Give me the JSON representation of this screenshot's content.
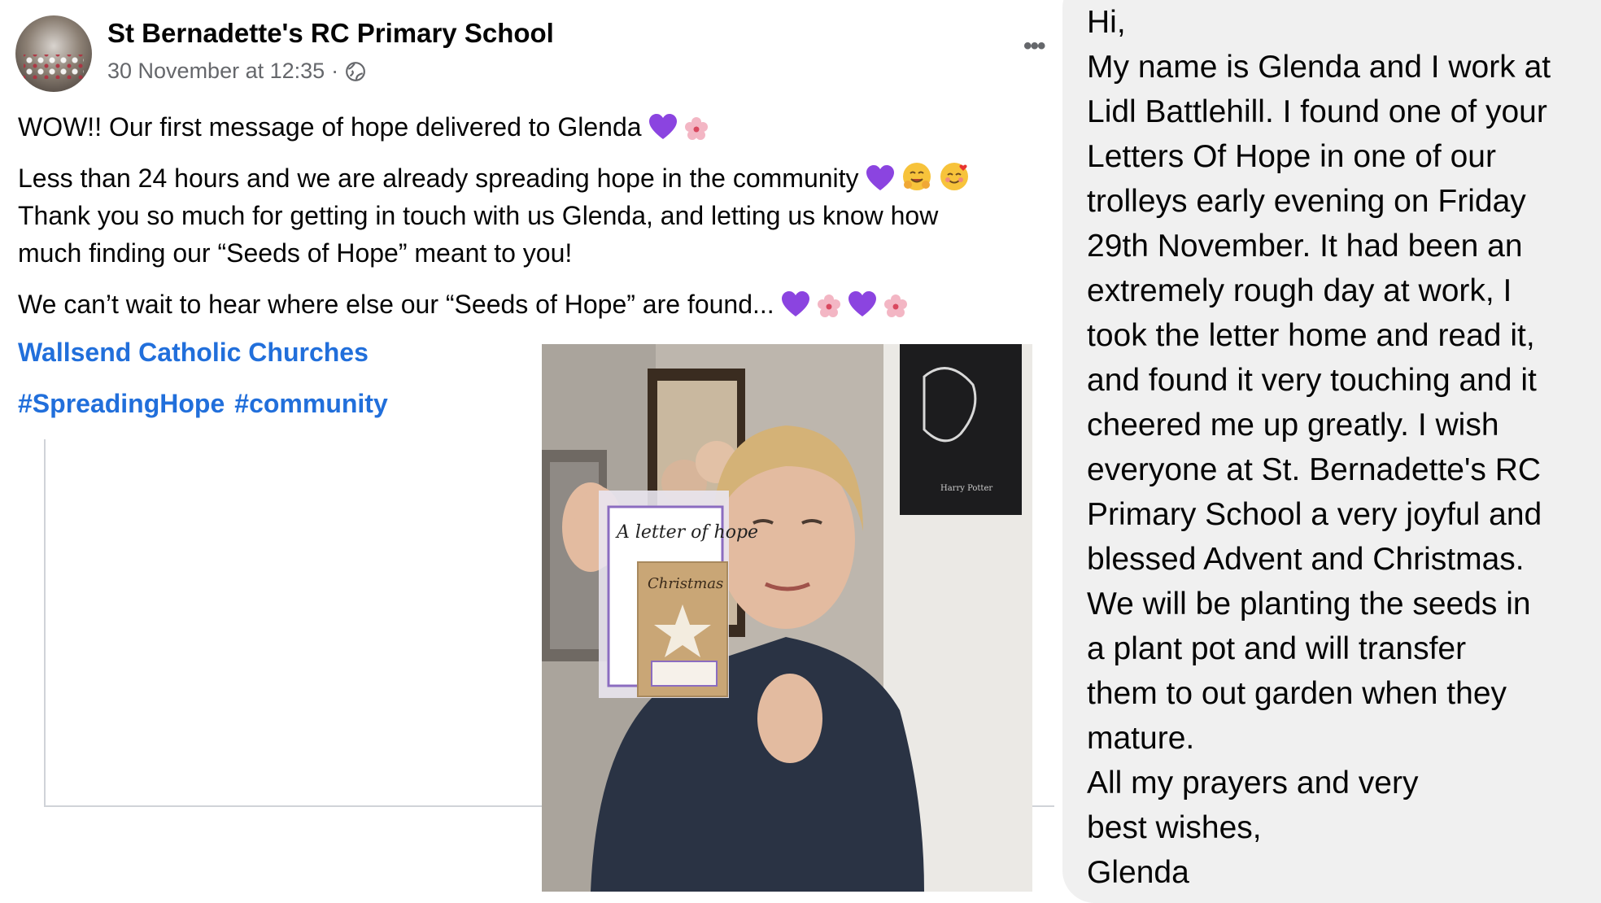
{
  "post": {
    "page_name": "St Bernadette's RC Primary School",
    "timestamp": "30 November at 12:35",
    "separator": "·",
    "audience_icon": "globe-icon",
    "more_label": "•••",
    "paragraphs": {
      "line1": "WOW!! Our first message of hope delivered to Glenda",
      "line2": "Less than 24 hours and we are already spreading hope in the community",
      "line3": "Thank you so much for getting in touch with us Glenda, and letting us know how",
      "line4": "much finding our “Seeds of Hope” meant to you!",
      "line5": "We can’t wait to hear where else our “Seeds of Hope” are found..."
    },
    "tagged_page": "Wallsend Catholic Churches",
    "hashtags": [
      "#SpreadingHope",
      "#community"
    ],
    "photo": {
      "letter_title": "A letter of hope",
      "card_title": "Christmas"
    }
  },
  "message": {
    "lines": [
      "Hi,",
      "My name is Glenda and I work at",
      "Lidl Battlehill. I found one of your",
      "Letters Of Hope in one of our",
      "trolleys early evening on Friday",
      "29th November. It had been an",
      "extremely rough day at work, I",
      "took the letter home and read it,",
      "and found it very touching and it",
      "cheered me up greatly. I wish",
      "everyone at St. Bernadette's RC",
      "Primary School a very joyful and",
      "blessed Advent and Christmas.",
      "We will be planting the seeds in",
      "a plant pot and will transfer",
      "them to out garden when they",
      "mature.",
      "All my prayers and very",
      "best wishes,",
      "Glenda"
    ]
  },
  "colors": {
    "link": "#216fdb",
    "meta": "#65676b",
    "bubble": "#f0f0f0",
    "heart": "#8b44e0",
    "blossom": "#f3b6c4"
  }
}
